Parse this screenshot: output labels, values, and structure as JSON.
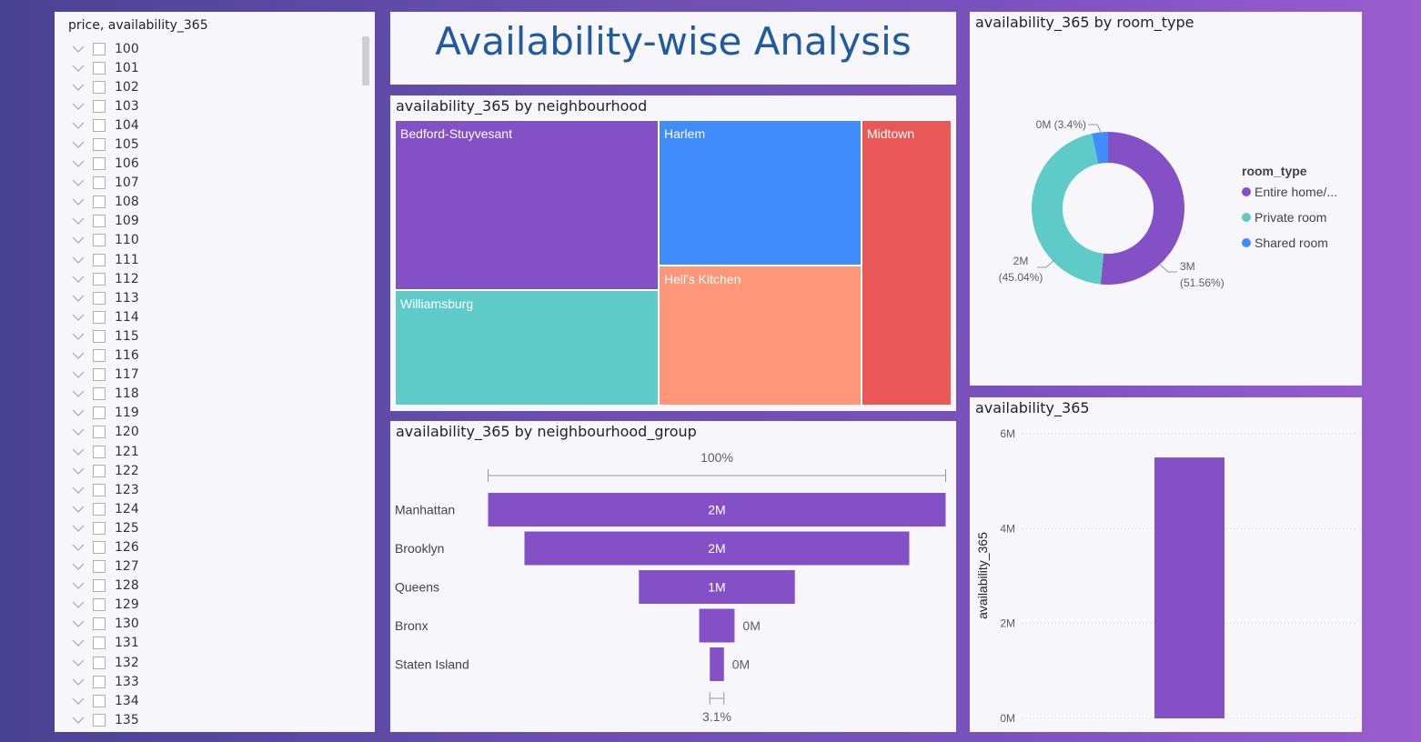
{
  "slicer": {
    "title": "price, availability_365",
    "items": [
      "100",
      "101",
      "102",
      "103",
      "104",
      "105",
      "106",
      "107",
      "108",
      "109",
      "110",
      "111",
      "112",
      "113",
      "114",
      "115",
      "116",
      "117",
      "118",
      "119",
      "120",
      "121",
      "122",
      "123",
      "124",
      "125",
      "126",
      "127",
      "128",
      "129",
      "130",
      "131",
      "132",
      "133",
      "134",
      "135"
    ]
  },
  "page_title": "Availability-wise Analysis",
  "chart_data": [
    {
      "type": "treemap",
      "title": "availability_365 by neighbourhood",
      "items": [
        {
          "name": "Bedford-Stuyvesant",
          "color": "#8350c6"
        },
        {
          "name": "Williamsburg",
          "color": "#5ecbc8"
        },
        {
          "name": "Harlem",
          "color": "#418cfc"
        },
        {
          "name": "Hell's Kitchen",
          "color": "#fe967a"
        },
        {
          "name": "Midtown",
          "color": "#ea5757"
        }
      ]
    },
    {
      "type": "funnel",
      "title": "availability_365 by neighbourhood_group",
      "top_label": "100%",
      "bottom_label": "3.1%",
      "categories": [
        "Manhattan",
        "Brooklyn",
        "Queens",
        "Bronx",
        "Staten Island"
      ],
      "values": [
        2.2,
        1.85,
        0.75,
        0.17,
        0.068
      ],
      "data_labels": [
        "2M",
        "2M",
        "1M",
        "0M",
        "0M"
      ],
      "color": "#8350c6"
    },
    {
      "type": "pie",
      "title": "availability_365 by room_type",
      "legend_title": "room_type",
      "legend_position": "right",
      "categories": [
        "Entire home/...",
        "Private room",
        "Shared room"
      ],
      "values": [
        51.56,
        45.04,
        3.4
      ],
      "data_labels": [
        "3M (51.56%)",
        "2M (45.04%)",
        "0M (3.4%)"
      ],
      "colors": [
        "#8350c6",
        "#5ecbc8",
        "#418cfc"
      ]
    },
    {
      "type": "bar",
      "title": "availability_365",
      "ylabel": "availability_365",
      "yticks": [
        "0M",
        "2M",
        "4M",
        "6M"
      ],
      "ylim": [
        0,
        6
      ],
      "values": [
        5.5
      ],
      "color": "#8350c6"
    }
  ]
}
